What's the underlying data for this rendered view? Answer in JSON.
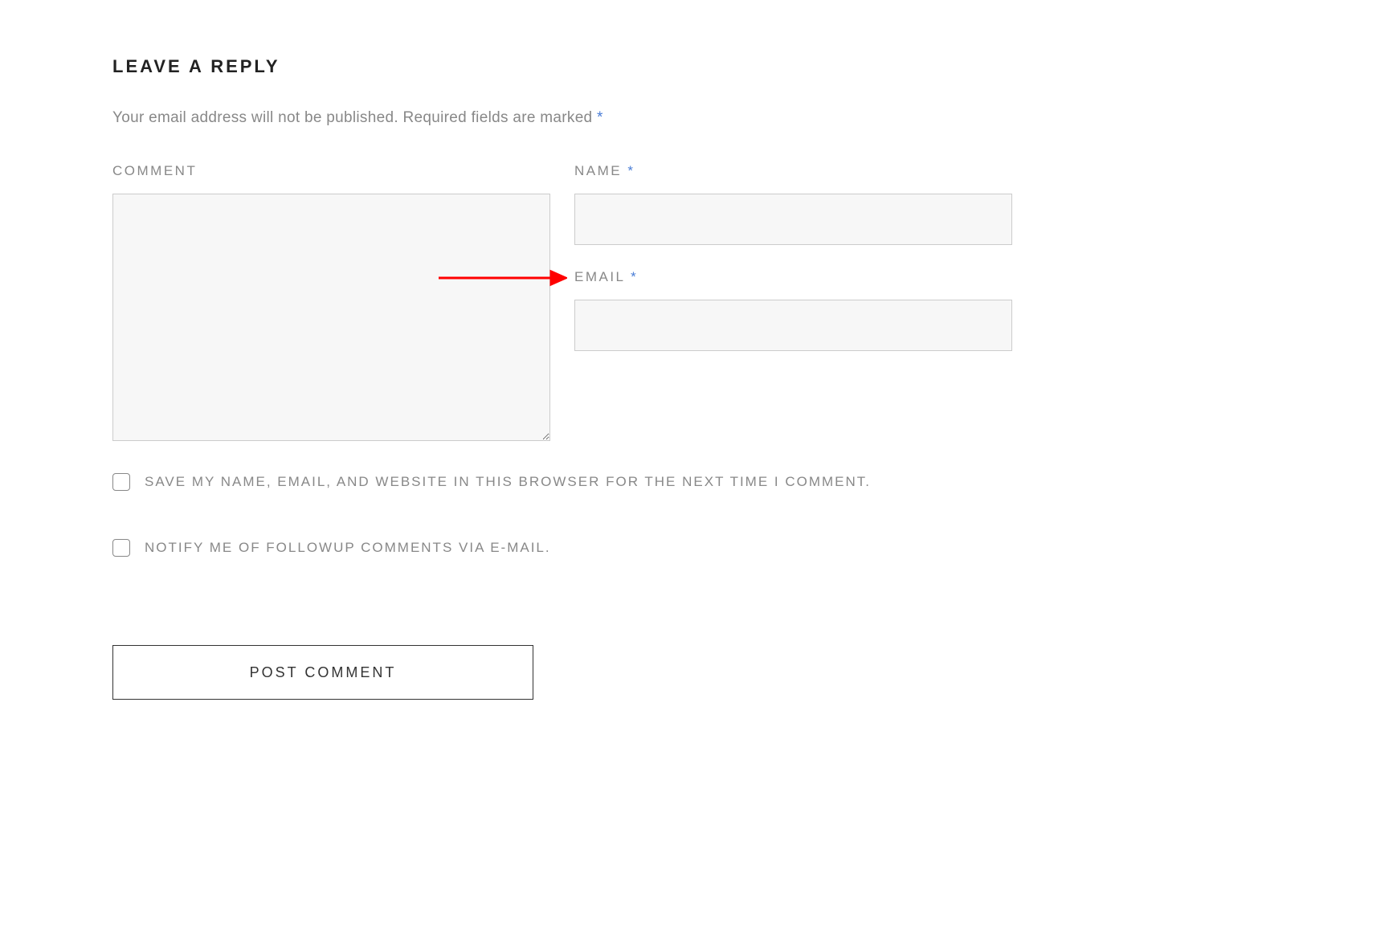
{
  "heading": "LEAVE A REPLY",
  "notice": {
    "text1": "Your email address will not be published.",
    "text2": "Required fields are marked ",
    "mark": "*"
  },
  "fields": {
    "comment": {
      "label": "COMMENT",
      "value": ""
    },
    "name": {
      "label": "NAME ",
      "required_mark": "*",
      "value": ""
    },
    "email": {
      "label": "EMAIL ",
      "required_mark": "*",
      "value": ""
    }
  },
  "checkboxes": {
    "save_info": {
      "label": "SAVE MY NAME, EMAIL, AND WEBSITE IN THIS BROWSER FOR THE NEXT TIME I COMMENT.",
      "checked": false
    },
    "notify": {
      "label": "NOTIFY ME OF FOLLOWUP COMMENTS VIA E-MAIL.",
      "checked": false
    }
  },
  "submit_label": "POST COMMENT"
}
